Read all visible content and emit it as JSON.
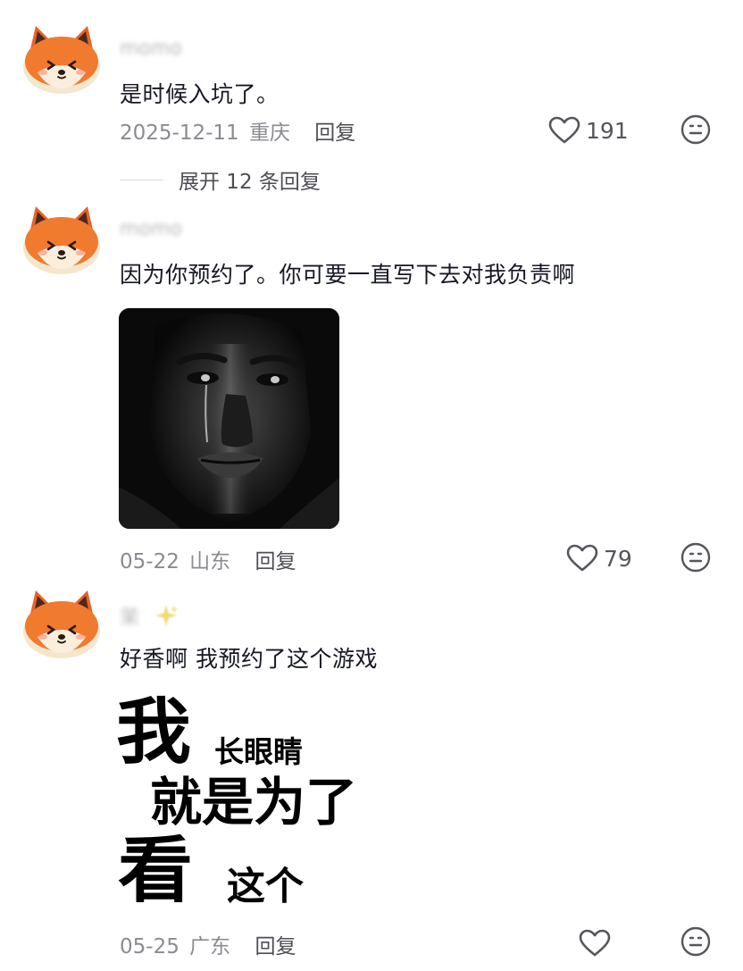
{
  "comments": [
    {
      "username": "momo",
      "text": "是时候入坑了。",
      "date": "2025-12-11",
      "location": "重庆",
      "reply_label": "回复",
      "likes": "191",
      "expand_label": "展开 12 条回复"
    },
    {
      "username": "momo",
      "text": "因为你预约了。你可要一直写下去对我负责啊",
      "date": "05-22",
      "location": "山东",
      "reply_label": "回复",
      "likes": "79"
    },
    {
      "username": "茉",
      "text": "好香啊 我预约了这个游戏",
      "date": "05-25",
      "location": "广东",
      "reply_label": "回复",
      "likes": "",
      "meme_text": {
        "line1_big": "我",
        "line1_small": "长眼睛",
        "line2": "就是为了",
        "line3_big": "看",
        "line3_small": "这个"
      }
    }
  ],
  "icons": {
    "avatar": "fox-avatar-icon",
    "like": "heart-outline-icon",
    "emoji": "neutral-face-icon",
    "sparkle": "sparkle-icon"
  },
  "colors": {
    "text_primary": "#161823",
    "text_secondary": "#8a8b91",
    "avatar_orange": "#f07a2e",
    "icon_gray": "#55565c"
  }
}
